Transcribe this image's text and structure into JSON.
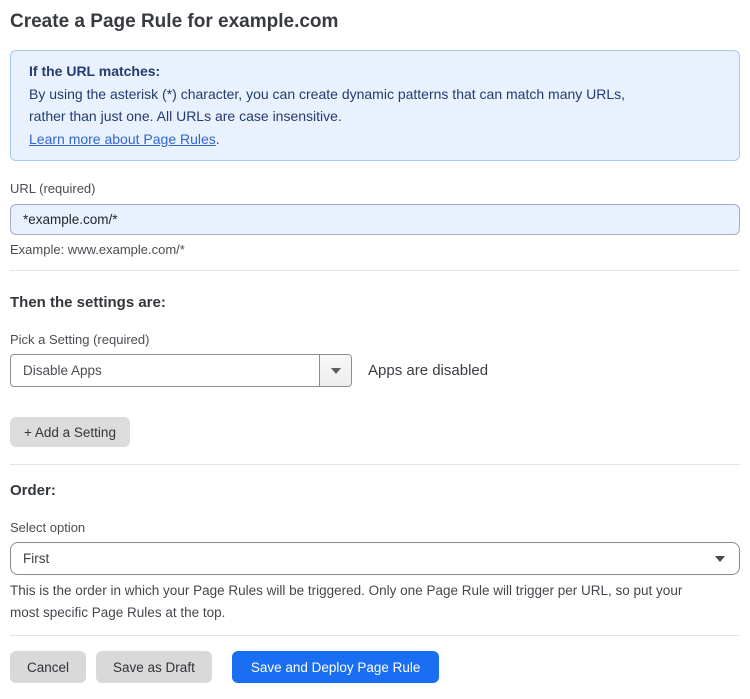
{
  "page": {
    "title": "Create a Page Rule for example.com"
  },
  "info_box": {
    "heading": "If the URL matches:",
    "body_line1": "By using the asterisk (*) character, you can create dynamic patterns that can match many URLs,",
    "body_line2": "rather than just one. All URLs are case insensitive.",
    "link_label": "Learn more about Page Rules",
    "link_suffix": "."
  },
  "url_field": {
    "label": "URL (required)",
    "value": "*example.com/*",
    "helper": "Example: www.example.com/*"
  },
  "settings_section": {
    "heading": "Then the settings are:",
    "setting_label": "Pick a Setting (required)",
    "setting_value": "Disable Apps",
    "setting_status": "Apps are disabled",
    "add_setting_label": "+ Add a Setting"
  },
  "order_section": {
    "heading": "Order:",
    "select_label": "Select option",
    "select_value": "First",
    "helper_line1": "This is the order in which your Page Rules will be triggered. Only one Page Rule will trigger per URL, so put your",
    "helper_line2": "most specific Page Rules at the top."
  },
  "footer": {
    "cancel_label": "Cancel",
    "save_draft_label": "Save as Draft",
    "save_deploy_label": "Save and Deploy Page Rule"
  },
  "colors": {
    "accent_blue": "#1a6ef2",
    "info_box_bg": "#e8f1fd",
    "info_box_border": "#a9c9ef",
    "info_text": "#233c6e",
    "link_blue": "#3366cc",
    "url_input_bg": "#e8f1fd",
    "button_gray": "#d9d9d9"
  }
}
